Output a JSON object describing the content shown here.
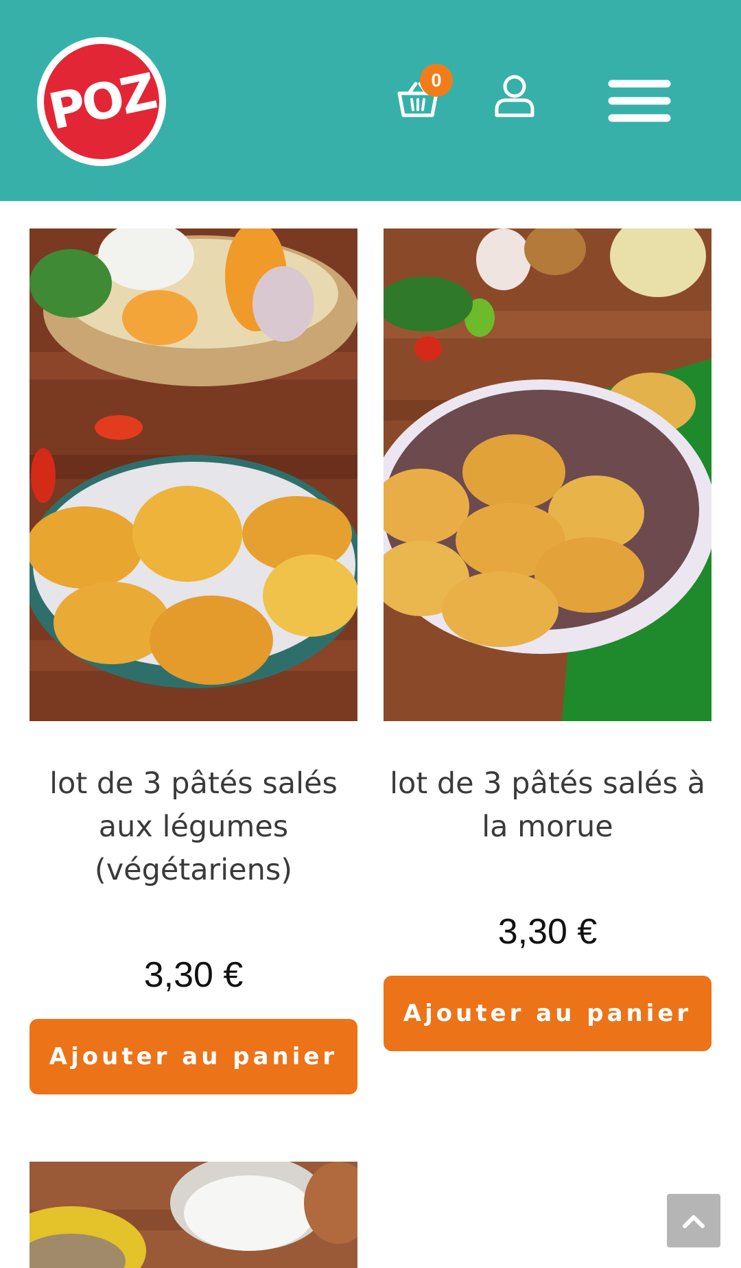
{
  "header": {
    "logo_text": "POZ",
    "cart_count": "0",
    "icons": {
      "cart": "cart-icon",
      "account": "user-icon",
      "menu": "menu-icon"
    },
    "background_color": "#37b0aa",
    "badge_color": "#f07d1a"
  },
  "products": [
    {
      "title": "lot de 3 pâtés salés aux légumes (végétariens)",
      "price": "3,30 €",
      "button_label": "Ajouter au panier"
    },
    {
      "title": "lot de 3 pâtés salés à la morue",
      "price": "3,30 €",
      "button_label": "Ajouter au panier"
    }
  ],
  "accent_color": "#ec7318",
  "scroll_top_icon": "chevron-up-icon"
}
